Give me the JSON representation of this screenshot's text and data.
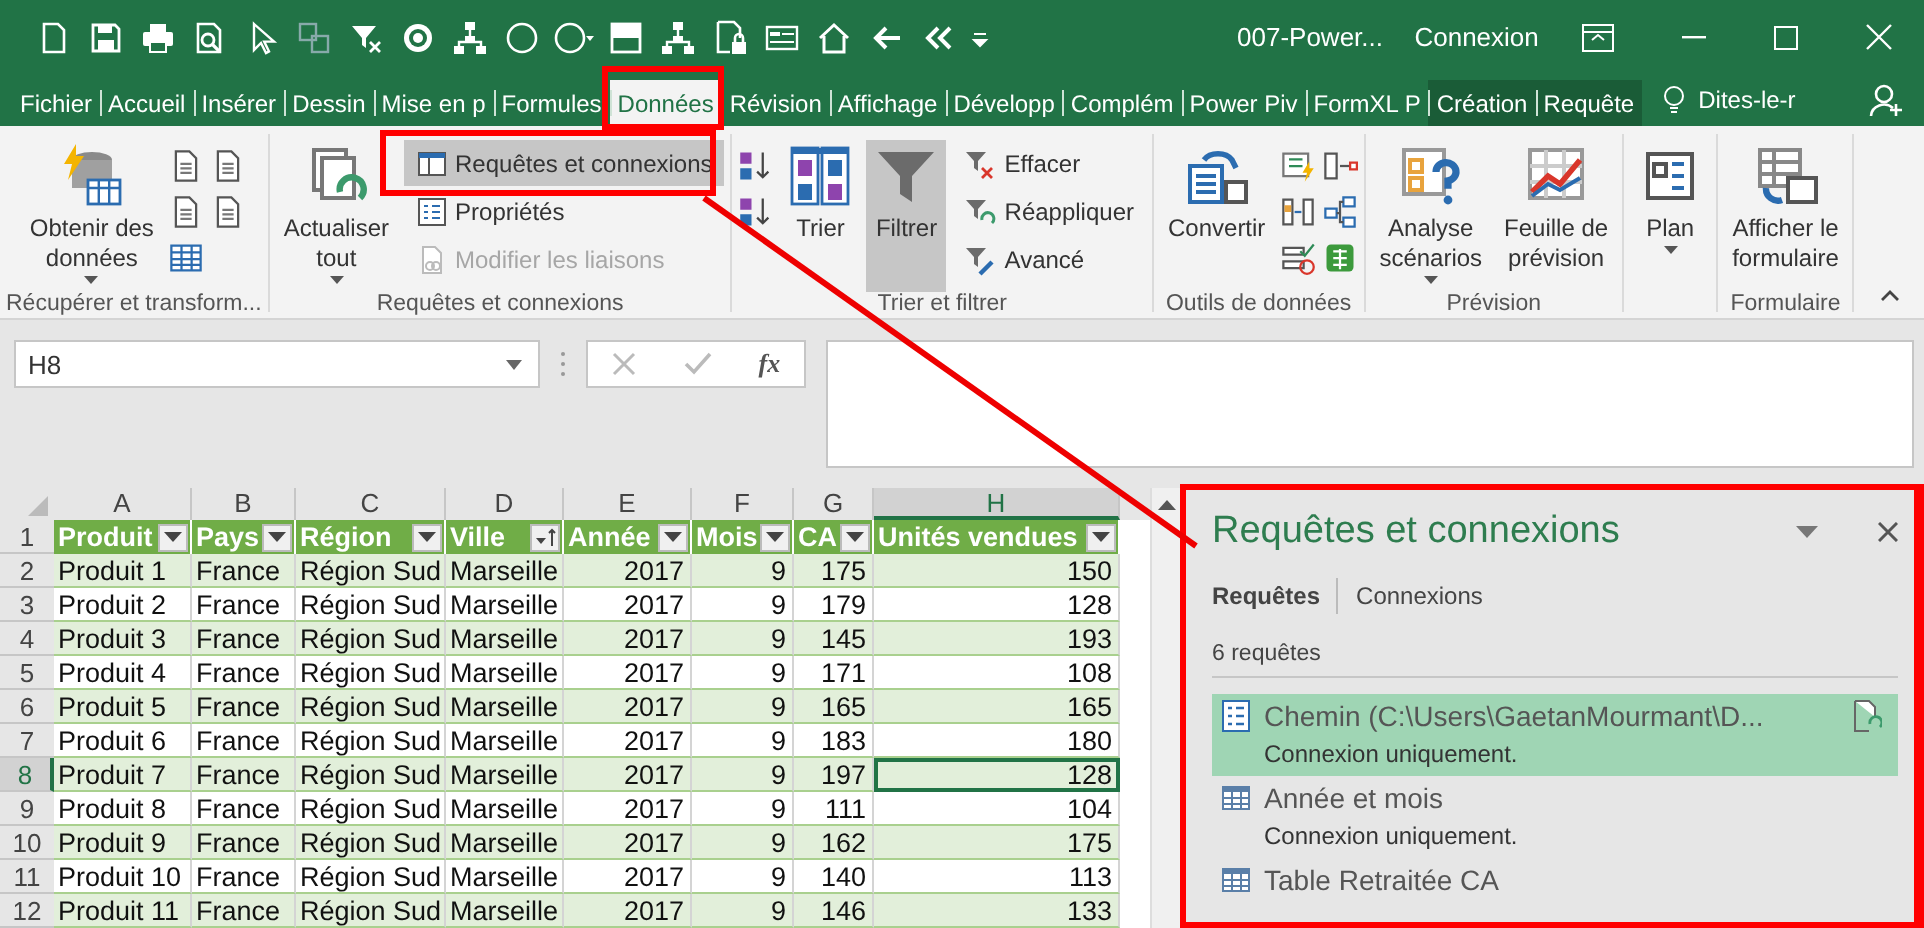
{
  "window": {
    "title": "007-Power...",
    "context_label": "Connexion"
  },
  "tabs": [
    {
      "label": "Fichier",
      "selected": false,
      "kind": "plain"
    },
    {
      "label": "Accueil",
      "selected": false,
      "kind": "plain"
    },
    {
      "label": "Insérer",
      "selected": false,
      "kind": "plain"
    },
    {
      "label": "Dessin",
      "selected": false,
      "kind": "plain"
    },
    {
      "label": "Mise en p",
      "selected": false,
      "kind": "plain"
    },
    {
      "label": "Formules",
      "selected": false,
      "kind": "plain"
    },
    {
      "label": "Données",
      "selected": true,
      "kind": "plain"
    },
    {
      "label": "Révision",
      "selected": false,
      "kind": "plain"
    },
    {
      "label": "Affichage",
      "selected": false,
      "kind": "plain"
    },
    {
      "label": "Développ",
      "selected": false,
      "kind": "plain"
    },
    {
      "label": "Complém",
      "selected": false,
      "kind": "plain"
    },
    {
      "label": "Power Piv",
      "selected": false,
      "kind": "plain"
    },
    {
      "label": "FormXL P",
      "selected": false,
      "kind": "plain"
    },
    {
      "label": "Création",
      "selected": false,
      "kind": "contextual"
    },
    {
      "label": "Requête",
      "selected": false,
      "kind": "contextual"
    }
  ],
  "tell_me": {
    "placeholder": "Dites-le-r"
  },
  "ribbon": {
    "groups": [
      {
        "label": "Récupérer et transform...",
        "columns": [
          {
            "kind": "large",
            "label": "Obtenir des\ndonnées",
            "dropdown": true,
            "selected": false
          },
          {
            "kind": "icons"
          },
          {
            "kind": "icons"
          }
        ]
      },
      {
        "label": "Requêtes et connexions",
        "columns": [
          {
            "kind": "large",
            "label": "Actualiser\ntout",
            "dropdown": true,
            "selected": false
          },
          {
            "kind": "stack",
            "buttons": [
              {
                "label": "Requêtes et connexions",
                "selected": true,
                "disabled": false
              },
              {
                "label": "Propriétés",
                "selected": false,
                "disabled": false
              },
              {
                "label": "Modifier les liaisons",
                "selected": false,
                "disabled": true
              }
            ]
          }
        ]
      },
      {
        "label": "Trier et filtrer",
        "columns": [
          {
            "kind": "icons"
          },
          {
            "kind": "large",
            "label": "Trier",
            "dropdown": false,
            "selected": false
          },
          {
            "kind": "large",
            "label": "Filtrer",
            "dropdown": false,
            "selected": true
          },
          {
            "kind": "stack",
            "buttons": [
              {
                "label": "Effacer",
                "selected": false,
                "disabled": false
              },
              {
                "label": "Réappliquer",
                "selected": false,
                "disabled": false
              },
              {
                "label": "Avancé",
                "selected": false,
                "disabled": false
              }
            ]
          }
        ]
      },
      {
        "label": "Outils de données",
        "columns": [
          {
            "kind": "large",
            "label": "Convertir",
            "dropdown": false,
            "selected": false
          },
          {
            "kind": "icons"
          },
          {
            "kind": "icons"
          }
        ]
      },
      {
        "label": "Prévision",
        "columns": [
          {
            "kind": "large",
            "label": "Analyse\nscénarios",
            "dropdown": true,
            "selected": false
          },
          {
            "kind": "large",
            "label": "Feuille de\nprévision",
            "dropdown": false,
            "selected": false
          }
        ]
      },
      {
        "columns": [
          {
            "kind": "large",
            "label": "Plan",
            "dropdown": true,
            "selected": false
          }
        ]
      },
      {
        "label": "Formulaire",
        "columns": [
          {
            "kind": "large",
            "label": "Afficher le\nformulaire",
            "dropdown": false,
            "selected": false
          }
        ]
      }
    ]
  },
  "formula_bar": {
    "name_box": "H8",
    "function_label": "fx"
  },
  "sheet": {
    "columns": [
      {
        "letter": "A",
        "selected": false
      },
      {
        "letter": "B",
        "selected": false
      },
      {
        "letter": "C",
        "selected": false
      },
      {
        "letter": "D",
        "selected": false
      },
      {
        "letter": "E",
        "selected": false
      },
      {
        "letter": "F",
        "selected": false
      },
      {
        "letter": "G",
        "selected": false
      },
      {
        "letter": "H",
        "selected": true
      }
    ],
    "header_row_number": "1",
    "table_headers": [
      {
        "label": "Produit",
        "numeric": false,
        "sorted": false
      },
      {
        "label": "Pays",
        "numeric": false,
        "sorted": false
      },
      {
        "label": "Région",
        "numeric": false,
        "sorted": false
      },
      {
        "label": "Ville",
        "numeric": false,
        "sorted": true
      },
      {
        "label": "Année",
        "numeric": true,
        "sorted": false
      },
      {
        "label": "Mois",
        "numeric": true,
        "sorted": false
      },
      {
        "label": "CA",
        "numeric": true,
        "sorted": false
      },
      {
        "label": "Unités vendues",
        "numeric": true,
        "sorted": false
      }
    ],
    "rows": [
      {
        "number": "2",
        "selected": false,
        "cells": [
          "Produit 1",
          "France",
          "Région Sud",
          "Marseille",
          "2017",
          "9",
          "175",
          "150"
        ]
      },
      {
        "number": "3",
        "selected": false,
        "cells": [
          "Produit 2",
          "France",
          "Région Sud",
          "Marseille",
          "2017",
          "9",
          "179",
          "128"
        ]
      },
      {
        "number": "4",
        "selected": false,
        "cells": [
          "Produit 3",
          "France",
          "Région Sud",
          "Marseille",
          "2017",
          "9",
          "145",
          "193"
        ]
      },
      {
        "number": "5",
        "selected": false,
        "cells": [
          "Produit 4",
          "France",
          "Région Sud",
          "Marseille",
          "2017",
          "9",
          "171",
          "108"
        ]
      },
      {
        "number": "6",
        "selected": false,
        "cells": [
          "Produit 5",
          "France",
          "Région Sud",
          "Marseille",
          "2017",
          "9",
          "165",
          "165"
        ]
      },
      {
        "number": "7",
        "selected": false,
        "cells": [
          "Produit 6",
          "France",
          "Région Sud",
          "Marseille",
          "2017",
          "9",
          "183",
          "180"
        ]
      },
      {
        "number": "8",
        "selected": true,
        "cells": [
          "Produit 7",
          "France",
          "Région Sud",
          "Marseille",
          "2017",
          "9",
          "197",
          "128"
        ]
      },
      {
        "number": "9",
        "selected": false,
        "cells": [
          "Produit 8",
          "France",
          "Région Sud",
          "Marseille",
          "2017",
          "9",
          "111",
          "104"
        ]
      },
      {
        "number": "10",
        "selected": false,
        "cells": [
          "Produit 9",
          "France",
          "Région Sud",
          "Marseille",
          "2017",
          "9",
          "162",
          "175"
        ]
      },
      {
        "number": "11",
        "selected": false,
        "cells": [
          "Produit 10",
          "France",
          "Région Sud",
          "Marseille",
          "2017",
          "9",
          "140",
          "113"
        ]
      },
      {
        "number": "12",
        "selected": false,
        "cells": [
          "Produit 11",
          "France",
          "Région Sud",
          "Marseille",
          "2017",
          "9",
          "146",
          "133"
        ]
      }
    ]
  },
  "pane": {
    "title": "Requêtes et connexions",
    "tabs": [
      {
        "label": "Requêtes",
        "selected": true
      },
      {
        "label": "Connexions",
        "selected": false
      }
    ],
    "count": "6 requêtes",
    "items": [
      {
        "kind": "parameter",
        "name": "Chemin (C:\\Users\\GaetanMourmant\\D...",
        "status": "Connexion uniquement.",
        "selected": true,
        "refresh_pending": true
      },
      {
        "kind": "table",
        "name": "Année et mois",
        "status": "Connexion uniquement.",
        "selected": false,
        "refresh_pending": false
      },
      {
        "kind": "table",
        "name": "Table Retraitée CA",
        "selected": false,
        "refresh_pending": false
      }
    ]
  }
}
